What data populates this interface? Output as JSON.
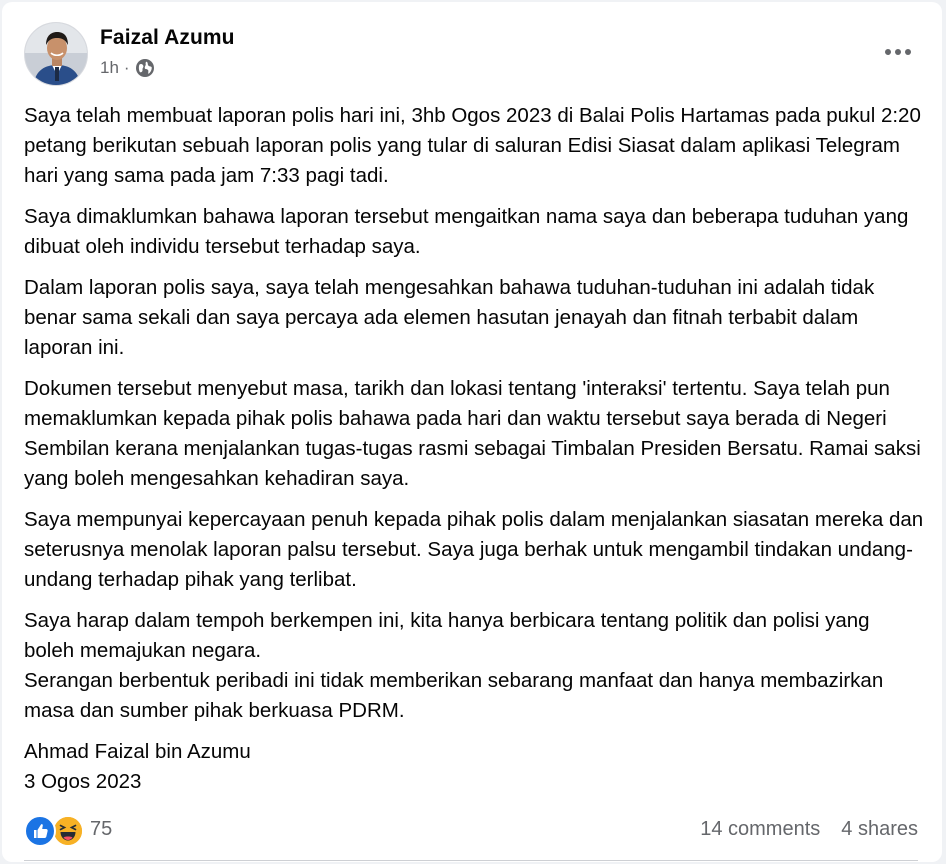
{
  "post": {
    "author": "Faizal Azumu",
    "time": "1h",
    "separator": "·",
    "audience_icon": "globe-icon",
    "more_icon": "more-horizontal-icon",
    "paragraphs": [
      "Saya telah membuat laporan polis hari ini, 3hb Ogos 2023 di Balai Polis Hartamas pada pukul 2:20 petang berikutan sebuah laporan polis yang tular di saluran Edisi Siasat dalam aplikasi Telegram hari yang sama pada jam 7:33 pagi tadi.",
      "Saya dimaklumkan bahawa laporan tersebut mengaitkan nama saya dan beberapa tuduhan yang dibuat oleh individu tersebut terhadap saya.",
      "Dalam laporan polis saya, saya telah mengesahkan bahawa tuduhan-tuduhan ini adalah tidak benar sama sekali dan saya percaya ada elemen hasutan jenayah dan fitnah terbabit dalam laporan ini.",
      "Dokumen tersebut menyebut masa, tarikh dan lokasi tentang 'interaksi' tertentu. Saya telah pun memaklumkan kepada pihak polis bahawa pada hari dan waktu tersebut saya berada di Negeri Sembilan kerana menjalankan tugas-tugas rasmi sebagai Timbalan Presiden Bersatu. Ramai saksi yang boleh mengesahkan kehadiran saya.",
      "Saya mempunyai kepercayaan penuh kepada pihak polis dalam menjalankan siasatan mereka dan seterusnya menolak laporan palsu tersebut. Saya juga berhak untuk mengambil tindakan undang-undang terhadap pihak yang terlibat.",
      "Saya harap dalam tempoh berkempen ini, kita hanya berbicara tentang politik dan polisi yang boleh memajukan negara.\nSerangan berbentuk peribadi ini tidak memberikan sebarang manfaat dan hanya membazirkan masa dan sumber pihak berkuasa PDRM.",
      "Ahmad Faizal bin Azumu\n3 Ogos 2023"
    ]
  },
  "footer": {
    "reaction_icons": [
      "like-reaction-icon",
      "haha-reaction-icon"
    ],
    "reaction_count": "75",
    "comments": "14 comments",
    "shares": "4 shares"
  },
  "colors": {
    "text": "#050505",
    "secondary_text": "#65676b",
    "like_blue": "#1b74e4",
    "haha_yellow": "#f7b125",
    "background": "#f0f2f5"
  }
}
